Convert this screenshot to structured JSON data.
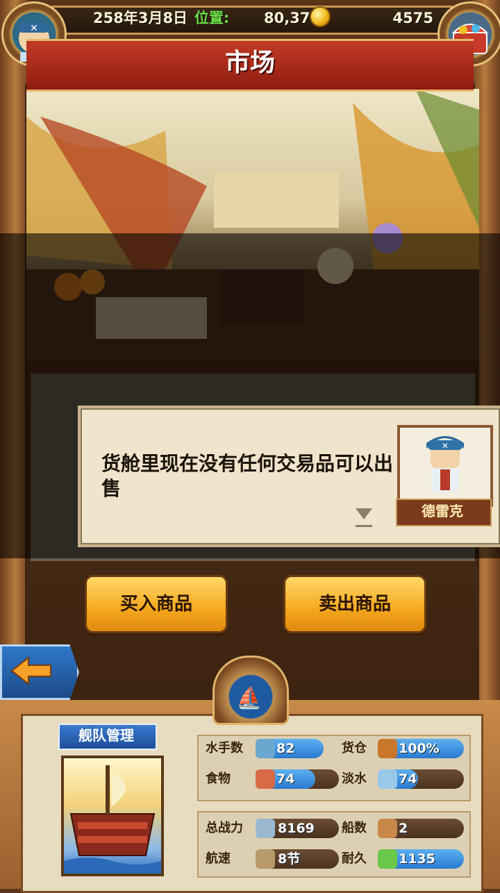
{
  "header": {
    "date": "258年3月8日",
    "location_label": "位置:",
    "location_value": "80,37",
    "gold": "4575",
    "title": "市场"
  },
  "dialog": {
    "text": "货舱里现在没有任何交易品可以出售",
    "npc_name": "德雷克"
  },
  "actions": {
    "buy_label": "买入商品",
    "sell_label": "卖出商品"
  },
  "fleet": {
    "label": "舰队管理",
    "stats": {
      "sailors_label": "水手数",
      "sailors_value": "82",
      "cargo_label": "货仓",
      "cargo_value": "100%",
      "food_label": "食物",
      "food_value": "74",
      "water_label": "淡水",
      "water_value": "74",
      "power_label": "总战力",
      "power_value": "8169",
      "ships_label": "船数",
      "ships_value": "2",
      "speed_label": "航速",
      "speed_value": "8节",
      "durability_label": "耐久",
      "durability_value": "1135"
    }
  },
  "icons": [
    "coin-icon",
    "treasure-chest-icon",
    "captain-avatar-icon",
    "back-arrow-icon",
    "boat-icon",
    "sailor-icon",
    "crate-icon",
    "meat-icon",
    "water-jug-icon",
    "swords-icon",
    "ship-count-icon",
    "sail-icon",
    "repair-icon"
  ],
  "colors": {
    "title_red": "#b12a18",
    "button_gold": "#f5a81c",
    "location_green": "#6fe04a",
    "bar_blue": "#2a7ad0"
  }
}
